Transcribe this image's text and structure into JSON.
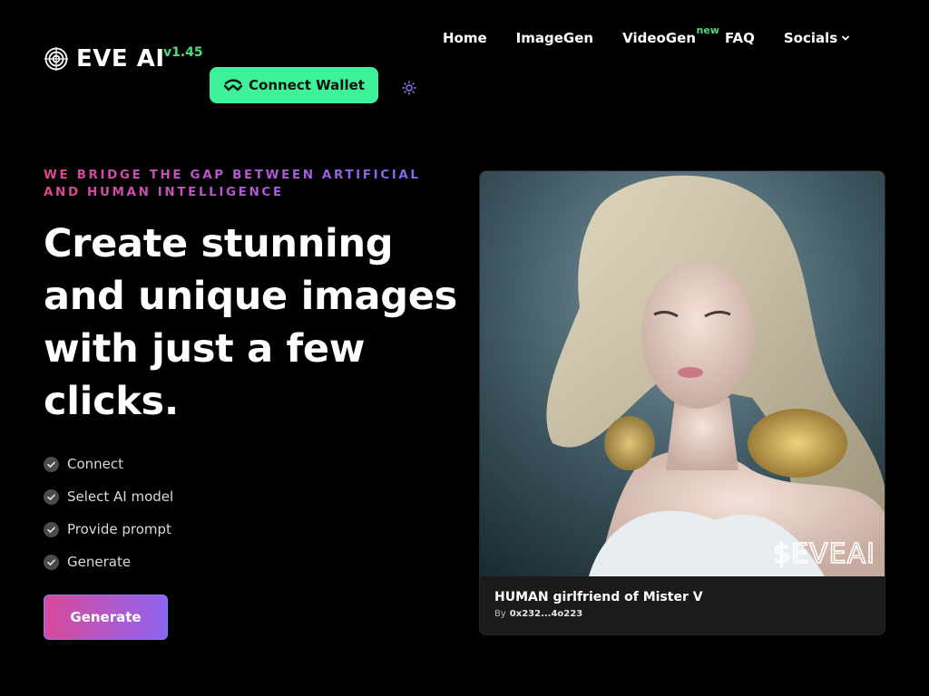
{
  "header": {
    "brand": "EVE AI",
    "version": "v1.45",
    "connect_label": "Connect Wallet"
  },
  "nav": {
    "items": [
      {
        "label": "Home"
      },
      {
        "label": "ImageGen"
      },
      {
        "label": "VideoGen",
        "badge": "new"
      },
      {
        "label": "FAQ"
      },
      {
        "label": "Socials"
      }
    ]
  },
  "hero": {
    "tagline": "WE BRIDGE THE GAP BETWEEN ARTIFICIAL AND HUMAN INTELLIGENCE",
    "headline": "Create stunning and unique images with just a few clicks.",
    "steps": [
      "Connect",
      "Select AI model",
      "Provide prompt",
      "Generate"
    ],
    "cta_label": "Generate"
  },
  "card": {
    "watermark": "$EVEAI",
    "title": "HUMAN girlfriend of Mister V",
    "by_label": "By",
    "author": "0x232...4o223"
  },
  "colors": {
    "accent_green": "#3ef29a",
    "version_green": "#4ade80",
    "gradient_pink": "#d84a9a",
    "gradient_purple": "#8f64f2"
  },
  "icons": {
    "logo": "target-icon",
    "wallet": "walletconnect-icon",
    "theme": "sun-icon",
    "socials": "chevron-down-icon",
    "step": "check-circle-icon"
  }
}
